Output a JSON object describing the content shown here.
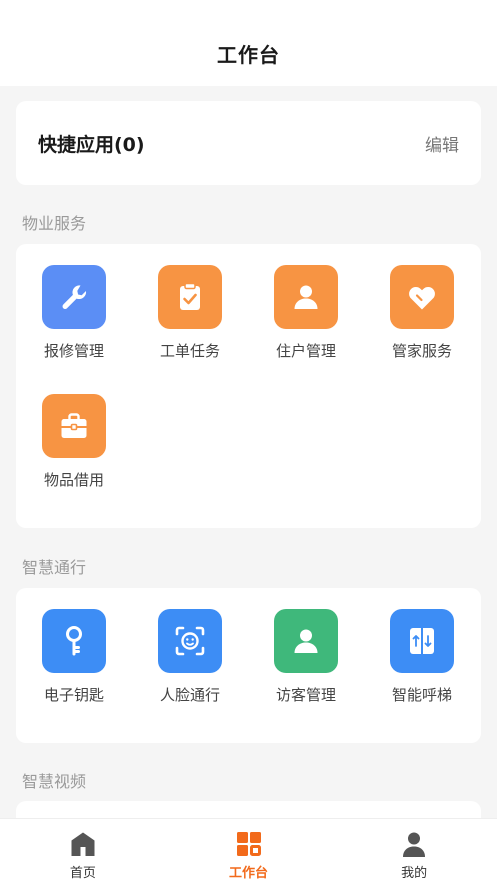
{
  "header": {
    "title": "工作台"
  },
  "quick": {
    "title": "快捷应用(0)",
    "edit": "编辑"
  },
  "sections": {
    "property": {
      "title": "物业服务",
      "items": [
        {
          "label": "报修管理",
          "icon": "wrench-icon",
          "color": "#5b8ef5"
        },
        {
          "label": "工单任务",
          "icon": "clipboard-check-icon",
          "color": "#f79443"
        },
        {
          "label": "住户管理",
          "icon": "person-icon",
          "color": "#f79443"
        },
        {
          "label": "管家服务",
          "icon": "heart-icon",
          "color": "#f79443"
        },
        {
          "label": "物品借用",
          "icon": "toolbox-icon",
          "color": "#f79443"
        }
      ]
    },
    "traffic": {
      "title": "智慧通行",
      "items": [
        {
          "label": "电子钥匙",
          "icon": "key-icon",
          "color": "#3d8df5"
        },
        {
          "label": "人脸通行",
          "icon": "face-scan-icon",
          "color": "#3d8df5"
        },
        {
          "label": "访客管理",
          "icon": "visitor-icon",
          "color": "#3fb87b"
        },
        {
          "label": "智能呼梯",
          "icon": "elevator-icon",
          "color": "#3d8df5"
        }
      ]
    },
    "video": {
      "title": "智慧视频"
    }
  },
  "tabbar": {
    "items": [
      {
        "label": "首页",
        "icon": "home-icon"
      },
      {
        "label": "工作台",
        "icon": "workbench-icon"
      },
      {
        "label": "我的",
        "icon": "profile-icon"
      }
    ],
    "active_color": "#f26a1b",
    "inactive_color": "#555555"
  }
}
